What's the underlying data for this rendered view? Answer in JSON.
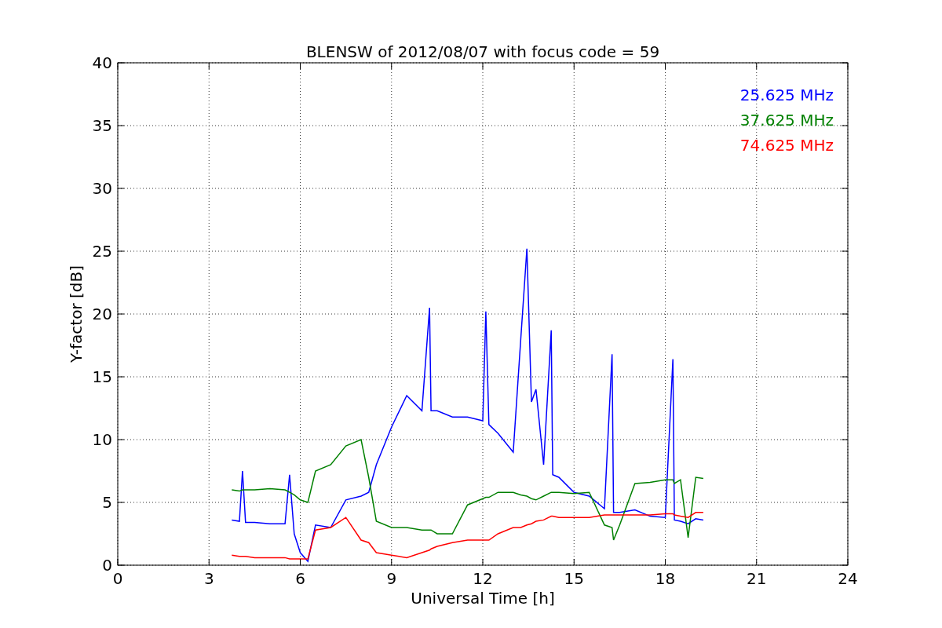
{
  "chart_data": {
    "type": "line",
    "title": "BLENSW of 2012/08/07 with focus code = 59",
    "xlabel": "Universal Time [h]",
    "ylabel": "Y-factor [dB]",
    "xlim": [
      0,
      24
    ],
    "ylim": [
      0,
      40
    ],
    "xticks": [
      0,
      3,
      6,
      9,
      12,
      15,
      18,
      21,
      24
    ],
    "yticks": [
      0,
      5,
      10,
      15,
      20,
      25,
      30,
      35,
      40
    ],
    "grid": true,
    "x": [
      3.75,
      4.0,
      4.1,
      4.2,
      4.5,
      5.0,
      5.5,
      5.65,
      5.8,
      6.0,
      6.25,
      6.5,
      7.0,
      7.5,
      8.0,
      8.25,
      8.5,
      9.0,
      9.5,
      10.0,
      10.25,
      10.3,
      10.5,
      11.0,
      11.5,
      12.0,
      12.1,
      12.2,
      12.5,
      13.0,
      13.25,
      13.45,
      13.6,
      13.75,
      14.0,
      14.25,
      14.3,
      14.5,
      15.0,
      15.5,
      16.0,
      16.25,
      16.3,
      16.5,
      17.0,
      17.5,
      18.0,
      18.25,
      18.3,
      18.5,
      18.75,
      19.0,
      19.25
    ],
    "series": [
      {
        "name": "25.625 MHz",
        "color": "#0000ff",
        "values": [
          3.6,
          3.5,
          7.5,
          3.4,
          3.4,
          3.3,
          3.3,
          7.2,
          2.5,
          1.0,
          0.3,
          3.2,
          3.0,
          5.2,
          5.5,
          5.8,
          8.0,
          11.0,
          13.5,
          12.3,
          20.5,
          12.3,
          12.3,
          11.8,
          11.8,
          11.5,
          20.2,
          11.2,
          10.5,
          9.0,
          18.0,
          25.2,
          13.0,
          14.0,
          8.0,
          18.7,
          7.2,
          7.0,
          5.8,
          5.5,
          4.5,
          16.8,
          4.2,
          4.2,
          4.4,
          3.9,
          3.8,
          16.4,
          3.6,
          3.5,
          3.3,
          3.7,
          3.6
        ]
      },
      {
        "name": "37.625 MHz",
        "color": "#008000",
        "values": [
          6.0,
          5.9,
          6.0,
          6.0,
          6.0,
          6.1,
          6.0,
          5.8,
          5.6,
          5.2,
          5.0,
          7.5,
          8.0,
          9.5,
          10.0,
          7.0,
          3.5,
          3.0,
          3.0,
          2.8,
          2.8,
          2.8,
          2.5,
          2.5,
          4.8,
          5.3,
          5.4,
          5.4,
          5.8,
          5.8,
          5.6,
          5.5,
          5.3,
          5.2,
          5.5,
          5.8,
          5.8,
          5.8,
          5.7,
          5.8,
          3.2,
          3.0,
          2.0,
          3.2,
          6.5,
          6.6,
          6.8,
          6.8,
          6.5,
          6.8,
          2.2,
          7.0,
          6.9
        ]
      },
      {
        "name": "74.625 MHz",
        "color": "#ff0000",
        "values": [
          0.8,
          0.7,
          0.7,
          0.7,
          0.6,
          0.6,
          0.6,
          0.5,
          0.5,
          0.5,
          0.5,
          2.8,
          3.0,
          3.8,
          2.0,
          1.8,
          1.0,
          0.8,
          0.6,
          1.0,
          1.2,
          1.3,
          1.5,
          1.8,
          2.0,
          2.0,
          2.0,
          2.0,
          2.5,
          3.0,
          3.0,
          3.2,
          3.3,
          3.5,
          3.6,
          3.9,
          3.9,
          3.8,
          3.8,
          3.8,
          4.0,
          4.0,
          4.0,
          4.0,
          4.0,
          4.0,
          4.1,
          4.1,
          4.0,
          3.9,
          3.8,
          4.2,
          4.2
        ]
      }
    ]
  }
}
